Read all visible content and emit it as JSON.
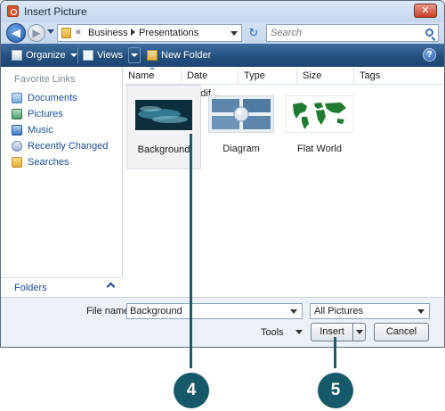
{
  "window": {
    "title": "Insert Picture",
    "close_label": "✕"
  },
  "address": {
    "chevrons": "«",
    "breadcrumbs": [
      "Business",
      "Presentations"
    ]
  },
  "search": {
    "placeholder": "Search"
  },
  "toolbar": {
    "organize": "Organize",
    "views": "Views",
    "new_folder": "New Folder",
    "help": "?"
  },
  "sidebar": {
    "heading": "Favorite Links",
    "items": [
      {
        "label": "Documents",
        "icon": "documents-icon"
      },
      {
        "label": "Pictures",
        "icon": "pictures-icon"
      },
      {
        "label": "Music",
        "icon": "music-icon"
      },
      {
        "label": "Recently Changed",
        "icon": "recently-changed-icon"
      },
      {
        "label": "Searches",
        "icon": "searches-icon"
      }
    ],
    "folders_label": "Folders"
  },
  "columns": [
    "Name",
    "Date modif...",
    "Type",
    "Size",
    "Tags"
  ],
  "files": [
    {
      "name": "Background",
      "selected": true
    },
    {
      "name": "Diagram",
      "selected": false
    },
    {
      "name": "Flat World",
      "selected": false
    }
  ],
  "footer": {
    "file_name_label": "File name:",
    "file_name_value": "Background",
    "file_type": "All Pictures",
    "tools_label": "Tools",
    "insert_label": "Insert",
    "cancel_label": "Cancel"
  },
  "callouts": [
    "4",
    "5"
  ],
  "colors": {
    "callout": "#165a6a",
    "command_bar": "#23507e",
    "link": "#1a4d94"
  }
}
